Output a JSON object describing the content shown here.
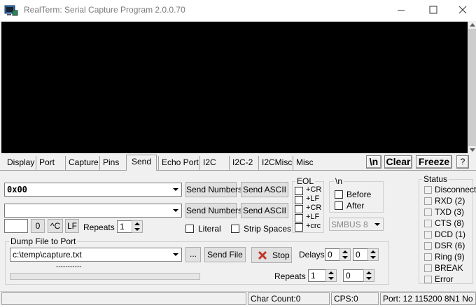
{
  "window": {
    "title": "RealTerm: Serial Capture Program 2.0.0.70",
    "minimize_glyph": "─",
    "maximize_glyph": "☐",
    "close_glyph": "✕",
    "icon": "serial-port-icon"
  },
  "tabs": [
    {
      "label": "Display"
    },
    {
      "label": "Port"
    },
    {
      "label": "Capture"
    },
    {
      "label": "Pins"
    },
    {
      "label": "Send",
      "active": true
    },
    {
      "label": "Echo Port"
    },
    {
      "label": "I2C"
    },
    {
      "label": "I2C-2"
    },
    {
      "label": "I2CMisc"
    },
    {
      "label": "Misc"
    }
  ],
  "toolbar": {
    "newline_label": "\\n",
    "clear_label": "Clear",
    "freeze_label": "Freeze",
    "help_label": "?"
  },
  "send": {
    "line1_value": "0x00",
    "line2_value": "",
    "send_numbers_label": "Send Numbers",
    "send_ascii_label": "Send ASCII",
    "small_value": "",
    "zero_label": "0",
    "ctrl_c_label": "^C",
    "lf_label": "LF",
    "repeats_label": "Repeats",
    "repeats_value": "1",
    "literal_label": "Literal",
    "strip_spaces_label": "Strip Spaces"
  },
  "eol": {
    "title": "EOL",
    "options": [
      "+CR",
      "+LF",
      "+CR",
      "+LF",
      "+crc"
    ]
  },
  "newline_group": {
    "title": "\\n",
    "before_label": "Before",
    "after_label": "After",
    "smbus_value": "SMBUS 8"
  },
  "dump": {
    "title": "Dump File to Port",
    "file_path": "c:\\temp\\capture.txt",
    "browse_label": "...",
    "send_file_label": "Send File",
    "stop_label": "Stop",
    "progress_text": "-----------",
    "delays_label": "Delays",
    "delay1_value": "0",
    "delay2_value": "0",
    "repeats_label": "Repeats",
    "repeats1_value": "1",
    "repeats2_value": "0"
  },
  "status": {
    "title": "Status",
    "items": [
      "Disconnect",
      "RXD (2)",
      "TXD (3)",
      "CTS (8)",
      "DCD (1)",
      "DSR (6)",
      "Ring (9)",
      "BREAK",
      "Error"
    ]
  },
  "statusbar": {
    "char_count": "Char Count:0",
    "cps": "CPS:0",
    "port": "Port: 12 115200 8N1 No"
  },
  "colors": {
    "terminal_bg": "#000000",
    "stop_icon": "#c0392b"
  }
}
